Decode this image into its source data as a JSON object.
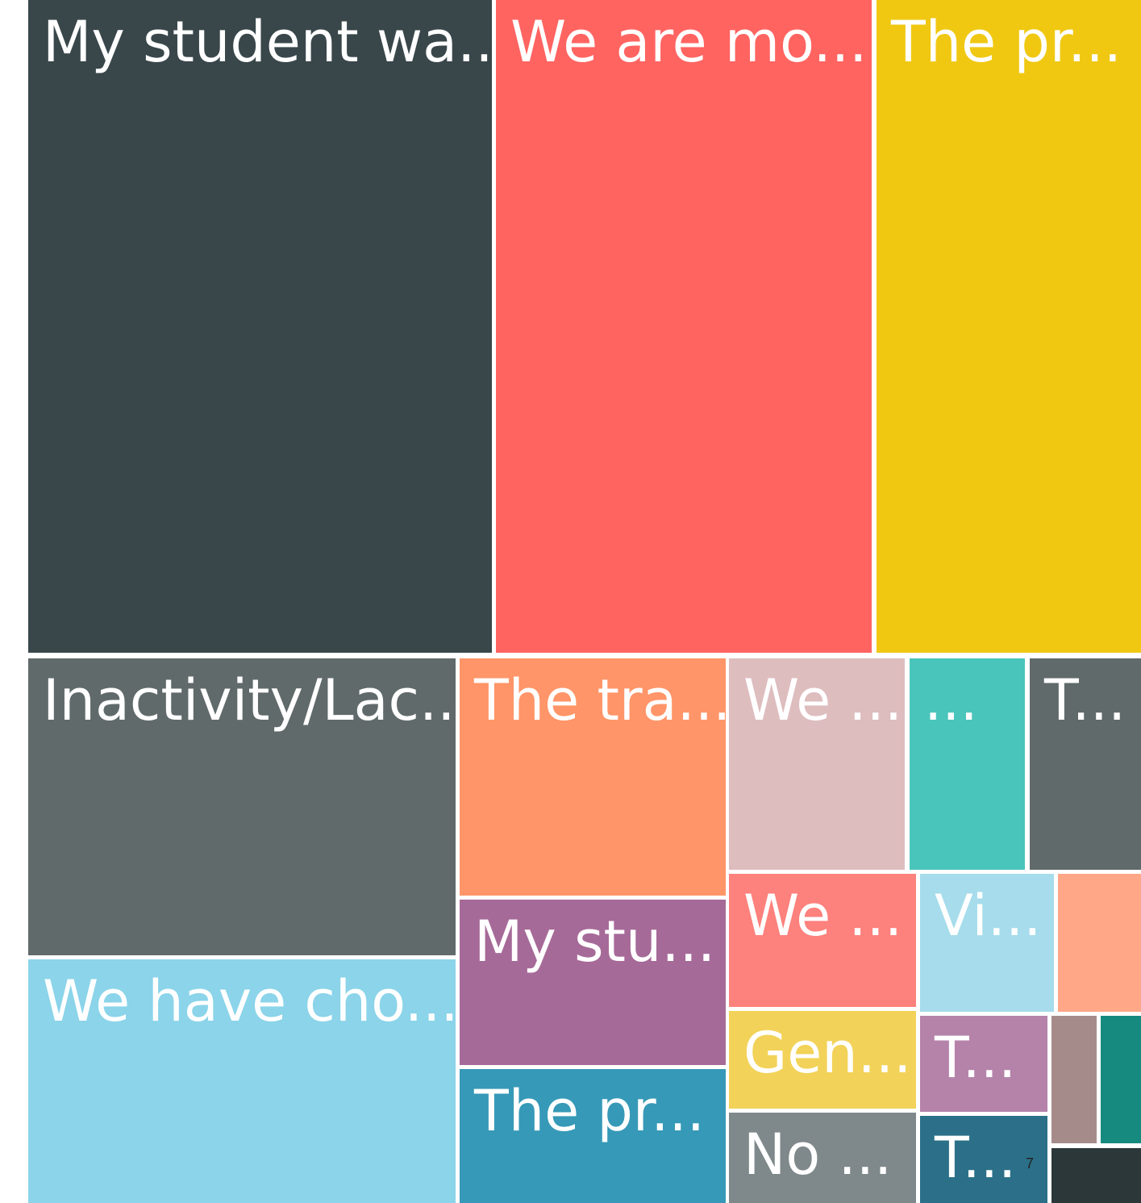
{
  "chart_data": {
    "type": "treemap",
    "title": "",
    "tiles": [
      {
        "label": "My student wa...",
        "color": "#39474B",
        "value": 468
      },
      {
        "label": "We are mo...",
        "color": "#FF6461",
        "value": 382
      },
      {
        "label": "The pr...",
        "color": "#F0C812",
        "value": 265
      },
      {
        "label": "Inactivity/Lac...",
        "color": "#616A6B",
        "value": 198
      },
      {
        "label": "We have cho...",
        "color": "#8BD4EA",
        "value": 163
      },
      {
        "label": "The tra...",
        "color": "#FF9568",
        "value": 98
      },
      {
        "label": "My stu...",
        "color": "#A66A98",
        "value": 68
      },
      {
        "label": "The pr...",
        "color": "#3699B7",
        "value": 55
      },
      {
        "label": "We ...",
        "color": "#DEBDBF",
        "value": 59
      },
      {
        "label": "...",
        "color": "#4AC5BB",
        "value": 38
      },
      {
        "label": "T...",
        "color": "#616A6B",
        "value": 35
      },
      {
        "label": "We ...",
        "color": "#FD817C",
        "value": 38
      },
      {
        "label": "Gen...",
        "color": "#F2D258",
        "value": 28
      },
      {
        "label": "No ...",
        "color": "#7F888A",
        "value": 28
      },
      {
        "label": "Vi...",
        "color": "#A6DCEB",
        "value": 25
      },
      {
        "label": "",
        "color": "#FFA787",
        "value": 17
      },
      {
        "label": "T...",
        "color": "#B583AA",
        "value": 16
      },
      {
        "label": "T...",
        "color": "#2B7088",
        "value": 13
      },
      {
        "label": "",
        "color": "#A58C8B",
        "value": 8
      },
      {
        "label": "",
        "color": "#178A80",
        "value": 7
      },
      {
        "label": "",
        "color": "#2C3739",
        "value": 9
      }
    ]
  },
  "page_number": "7"
}
